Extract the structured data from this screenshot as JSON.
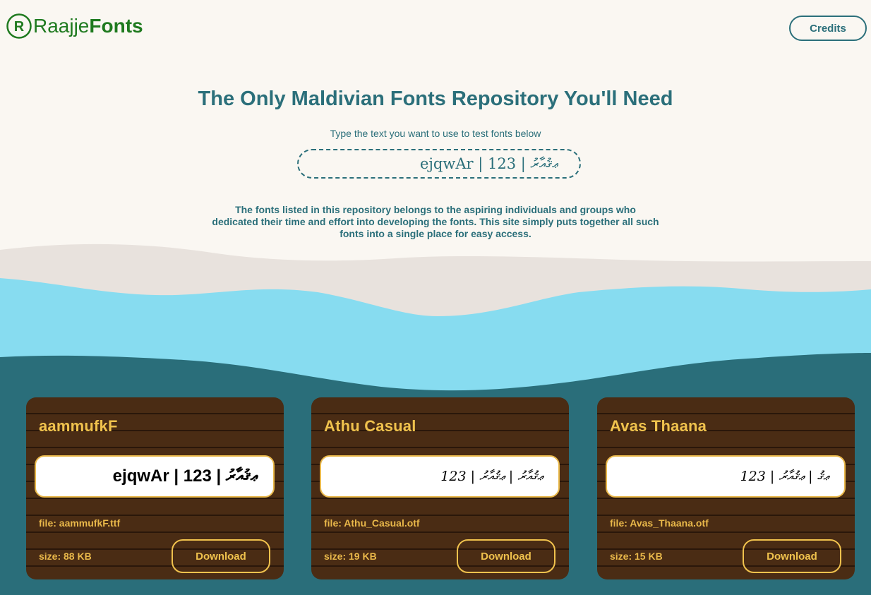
{
  "header": {
    "logo_light": "Raajje",
    "logo_bold": "Fonts",
    "credits_label": "Credits"
  },
  "hero": {
    "title": "The Only Maldivian Fonts Repository You'll Need",
    "subtitle": "Type the text you want to use to test fonts below",
    "test_text": "ejqwAr | ޢޤުއާރު | 123",
    "description": "The fonts listed in this repository belongs to the aspiring individuals and groups who dedicated their time and effort into developing the fonts. This site simply puts together all such fonts into a single place for easy access."
  },
  "colors": {
    "accent": "#2b6f7a",
    "logo_green": "#1f7a1f",
    "sand_light": "#faf7f2",
    "sand_dark": "#e8e2dd",
    "water_light": "#87dcf0",
    "water_deep": "#2a6e7a",
    "card_wood": "#4a2c14",
    "card_gold": "#f0c24d"
  },
  "fonts": [
    {
      "name": "aammufkF",
      "preview": "ejqwAr | ޢޤުއާރު | 123",
      "file_label": "file: aammufkF.ttf",
      "size_label": "size: 88 KB",
      "download_label": "Download"
    },
    {
      "name": "Athu Casual",
      "preview": "ޢޤުއާރު | ޢޤުއާރު | 123",
      "file_label": "file: Athu_Casual.otf",
      "size_label": "size: 19 KB",
      "download_label": "Download"
    },
    {
      "name": "Avas Thaana",
      "preview": "ޢޤު | ޢޤުއާރު | 123",
      "file_label": "file: Avas_Thaana.otf",
      "size_label": "size: 15 KB",
      "download_label": "Download"
    }
  ]
}
